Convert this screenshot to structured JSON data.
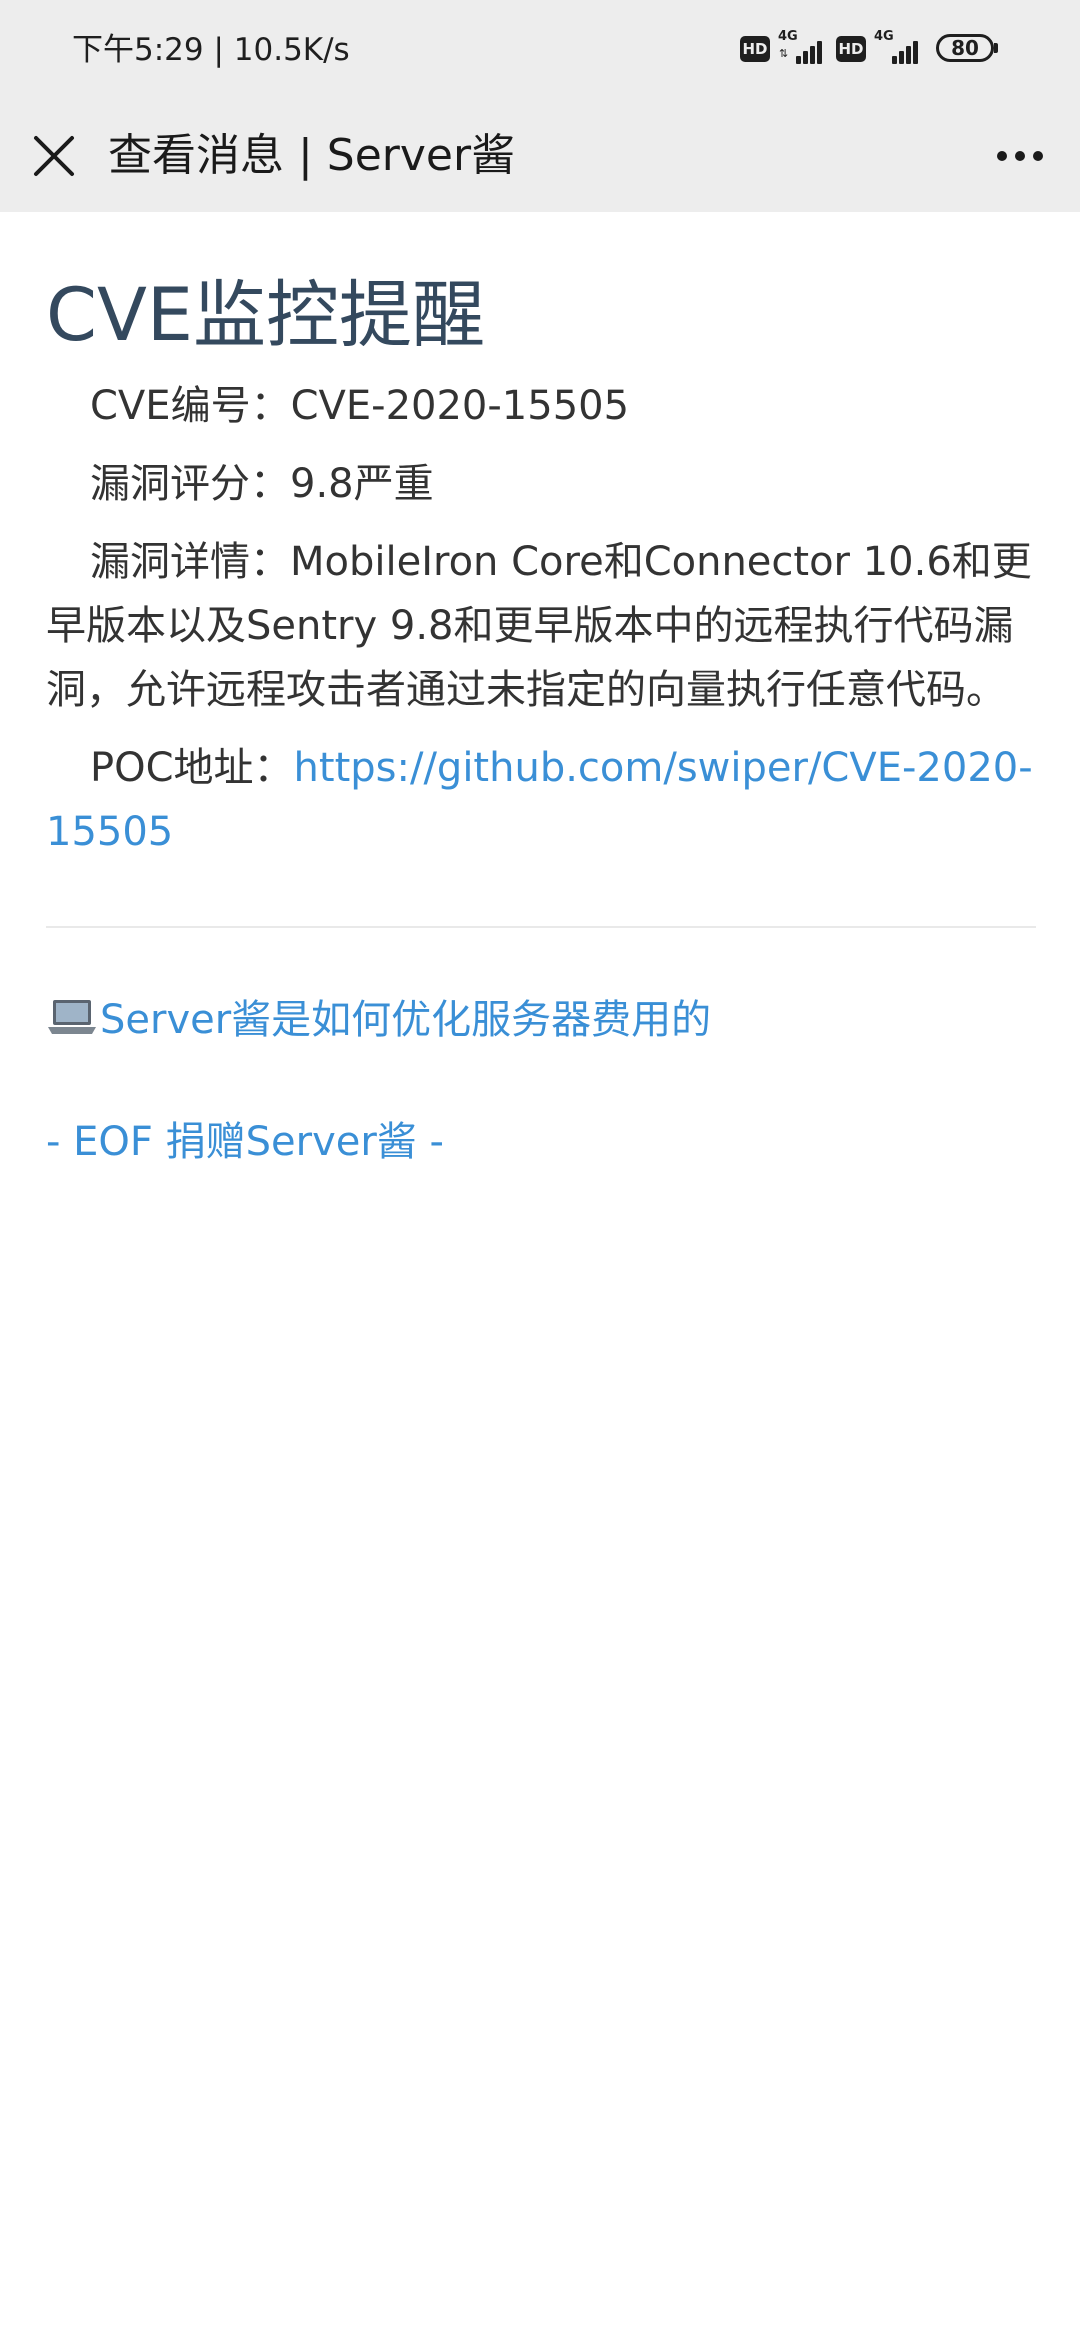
{
  "status_bar": {
    "time_speed": "下午5:29 | 10.5K/s",
    "hd_label": "HD",
    "network_type": "4G",
    "battery_level": "80"
  },
  "nav": {
    "title": "查看消息 | Server酱",
    "close_icon": "close-icon",
    "more_icon": "more-dots-icon"
  },
  "article": {
    "title": "CVE监控提醒",
    "cve_id": "CVE编号：CVE-2020-15505",
    "score": "漏洞评分：9.8严重",
    "details": "漏洞详情：MobileIron Core和Connector 10.6和更早版本以及Sentry 9.8和更早版本中的远程执行代码漏洞，允许远程攻击者通过未指定的向量执行任意代码。",
    "poc_label": "POC地址：",
    "poc_url": "https://github.com/swiper/CVE-2020-15505"
  },
  "footer": {
    "promo_link": "Server酱是如何优化服务器费用的",
    "promo_icon": "laptop-icon",
    "eof_line": "- EOF 捐赠Server酱 -"
  },
  "colors": {
    "link": "#3a8fd6",
    "title": "#34495e",
    "bar_background": "#ededed"
  }
}
